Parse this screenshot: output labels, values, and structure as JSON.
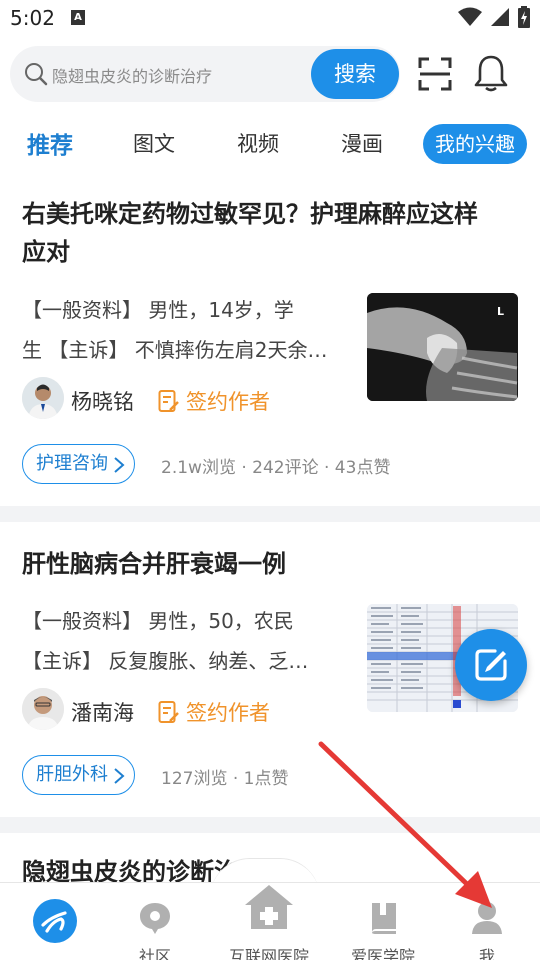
{
  "status": {
    "time": "5:02",
    "sim_label": "A"
  },
  "search": {
    "placeholder": "隐翅虫皮炎的诊断治疗",
    "button_label": "搜索"
  },
  "tabs": [
    {
      "label": "推荐",
      "active": true
    },
    {
      "label": "图文"
    },
    {
      "label": "视频"
    },
    {
      "label": "漫画"
    },
    {
      "label": "我的兴趣",
      "pill": true
    }
  ],
  "articles": [
    {
      "title_line1": "右美托咪定药物过敏罕见？护理麻醉应这样",
      "title_line2": "应对",
      "excerpt_line1": "【一般资料】 男性，14岁，学",
      "excerpt_line2": "生 【主诉】 不慎摔伤左肩2天余…",
      "author": "杨晓铭",
      "sign_label": "签约作者",
      "tag": "护理咨询",
      "stats": "2.1w浏览 · 242评论 · 43点赞",
      "thumb_mark": "L"
    },
    {
      "title_line1": "肝性脑病合并肝衰竭一例",
      "excerpt_line1": "【一般资料】 男性，50，农民",
      "excerpt_line2": "【主诉】 反复腹胀、纳差、乏…",
      "author": "潘南海",
      "sign_label": "签约作者",
      "tag": "肝胆外科",
      "stats": "127浏览 · 1点赞"
    },
    {
      "title_line1": "隐翅虫皮炎的诊断治"
    }
  ],
  "bottom_nav": [
    {
      "label": ""
    },
    {
      "label": "社区"
    },
    {
      "label": "互联网医院"
    },
    {
      "label": "爱医学院"
    },
    {
      "label": "我"
    }
  ],
  "colors": {
    "accent": "#1e8fe8",
    "sign": "#f0932b",
    "annotation": "#e53935"
  }
}
